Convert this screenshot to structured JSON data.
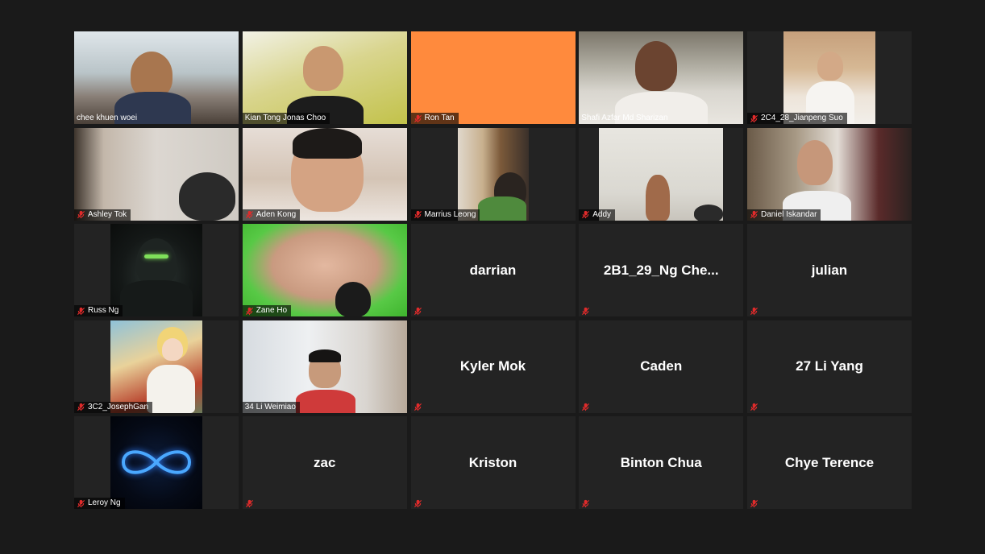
{
  "colors": {
    "background": "#1a1a1a",
    "tile": "#232323",
    "active_speaker_border": "#b9d43a",
    "mute_icon": "#e02b2b"
  },
  "participants": [
    {
      "name": "chee khuen woei",
      "kind": "camera",
      "muted": false
    },
    {
      "name": "Kian Tong Jonas Choo",
      "kind": "camera",
      "muted": false,
      "active_speaker": true
    },
    {
      "name": "Ron Tan",
      "kind": "camera",
      "muted": true
    },
    {
      "name": "Shafi Azfar Md Sharizan",
      "kind": "camera",
      "muted": false
    },
    {
      "name": "2C4_28_Jianpeng Suo",
      "kind": "camera",
      "muted": true
    },
    {
      "name": "Ashley Tok",
      "kind": "camera",
      "muted": true
    },
    {
      "name": "Aden Kong",
      "kind": "camera",
      "muted": true
    },
    {
      "name": "Marrius Leong",
      "kind": "camera",
      "muted": true
    },
    {
      "name": "Addy",
      "kind": "camera",
      "muted": true
    },
    {
      "name": "Daniel Iskandar",
      "kind": "camera",
      "muted": true
    },
    {
      "name": "Russ Ng",
      "kind": "avatar",
      "muted": true
    },
    {
      "name": "Zane Ho",
      "kind": "camera",
      "muted": true
    },
    {
      "name": "darrian",
      "kind": "name-only",
      "muted": true
    },
    {
      "name": "2B1_29_Ng  Che...",
      "kind": "name-only",
      "muted": true
    },
    {
      "name": "julian",
      "kind": "name-only",
      "muted": true
    },
    {
      "name": "3C2_JosephGan",
      "kind": "avatar",
      "muted": true
    },
    {
      "name": "34 Li Weimiao",
      "kind": "camera",
      "muted": false
    },
    {
      "name": "Kyler Mok",
      "kind": "name-only",
      "muted": true
    },
    {
      "name": "Caden",
      "kind": "name-only",
      "muted": true
    },
    {
      "name": "27 Li Yang",
      "kind": "name-only",
      "muted": true
    },
    {
      "name": "Leroy Ng",
      "kind": "avatar",
      "muted": true
    },
    {
      "name": "zac",
      "kind": "name-only",
      "muted": true
    },
    {
      "name": "Kriston",
      "kind": "name-only",
      "muted": true
    },
    {
      "name": "Binton Chua",
      "kind": "name-only",
      "muted": true
    },
    {
      "name": "Chye Terence",
      "kind": "name-only",
      "muted": true
    }
  ]
}
